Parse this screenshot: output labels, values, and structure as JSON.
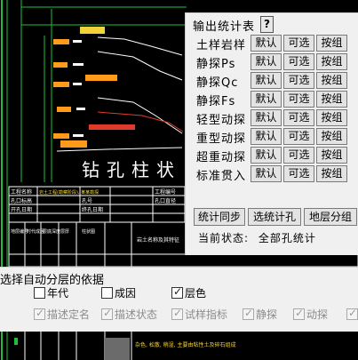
{
  "drawing": {
    "title": "钻孔柱状",
    "header_cells": [
      "工程名称",
      "岩土工程(勘察阶段), 某某勘探",
      "工程编号",
      "孔口标高",
      "孔号",
      "孔口直径",
      "开孔日期",
      "终孔日期"
    ],
    "column_headers": [
      "地层编号",
      "时代成因",
      "层底深度",
      "层厚",
      "柱状图",
      "岩土名称及其特征"
    ],
    "desc_note": "杂色, 松散, 稍湿,  主要由粘性土及碎石组成"
  },
  "stats_dialog": {
    "title": "输出统计表",
    "help_label": "?",
    "rows": [
      {
        "label": "土样岩样",
        "b1": "默认",
        "b2": "可选",
        "b3": "按组"
      },
      {
        "label": "静探Ps",
        "b1": "默认",
        "b2": "可选",
        "b3": "按组"
      },
      {
        "label": "静探Qc",
        "b1": "默认",
        "b2": "可选",
        "b3": "按组"
      },
      {
        "label": "静探Fs",
        "b1": "默认",
        "b2": "可选",
        "b3": "按组"
      },
      {
        "label": "轻型动探",
        "b1": "默认",
        "b2": "可选",
        "b3": "按组"
      },
      {
        "label": "重型动探",
        "b1": "默认",
        "b2": "可选",
        "b3": "按组"
      },
      {
        "label": "超重动探",
        "b1": "默认",
        "b2": "可选",
        "b3": "按组"
      },
      {
        "label": "标准贯入",
        "b1": "默认",
        "b2": "可选",
        "b3": "按组"
      }
    ],
    "actions": [
      "统计同步",
      "选统计孔",
      "地层分组"
    ],
    "status_label": "当前状态:",
    "status_value": "全部孔统计"
  },
  "layer_panel": {
    "title": "选择自动分层的依据",
    "row1": [
      {
        "label": "年代",
        "checked": false
      },
      {
        "label": "成因",
        "checked": false
      },
      {
        "label": "层色",
        "checked": true
      }
    ],
    "row2": [
      {
        "label": "描述定名",
        "checked": true,
        "disabled": true
      },
      {
        "label": "描述状态",
        "checked": true,
        "disabled": true
      },
      {
        "label": "试样指标",
        "checked": true,
        "disabled": true
      },
      {
        "label": "静探",
        "checked": true,
        "disabled": true
      },
      {
        "label": "动探",
        "checked": true,
        "disabled": true
      }
    ]
  },
  "colors": {
    "grid_green": "#1fbf3a",
    "label_yellow": "#f2d23a",
    "hatch_orange": "#ff9a1a",
    "curve_red": "#e03a2a",
    "line_white": "#ffffff"
  }
}
